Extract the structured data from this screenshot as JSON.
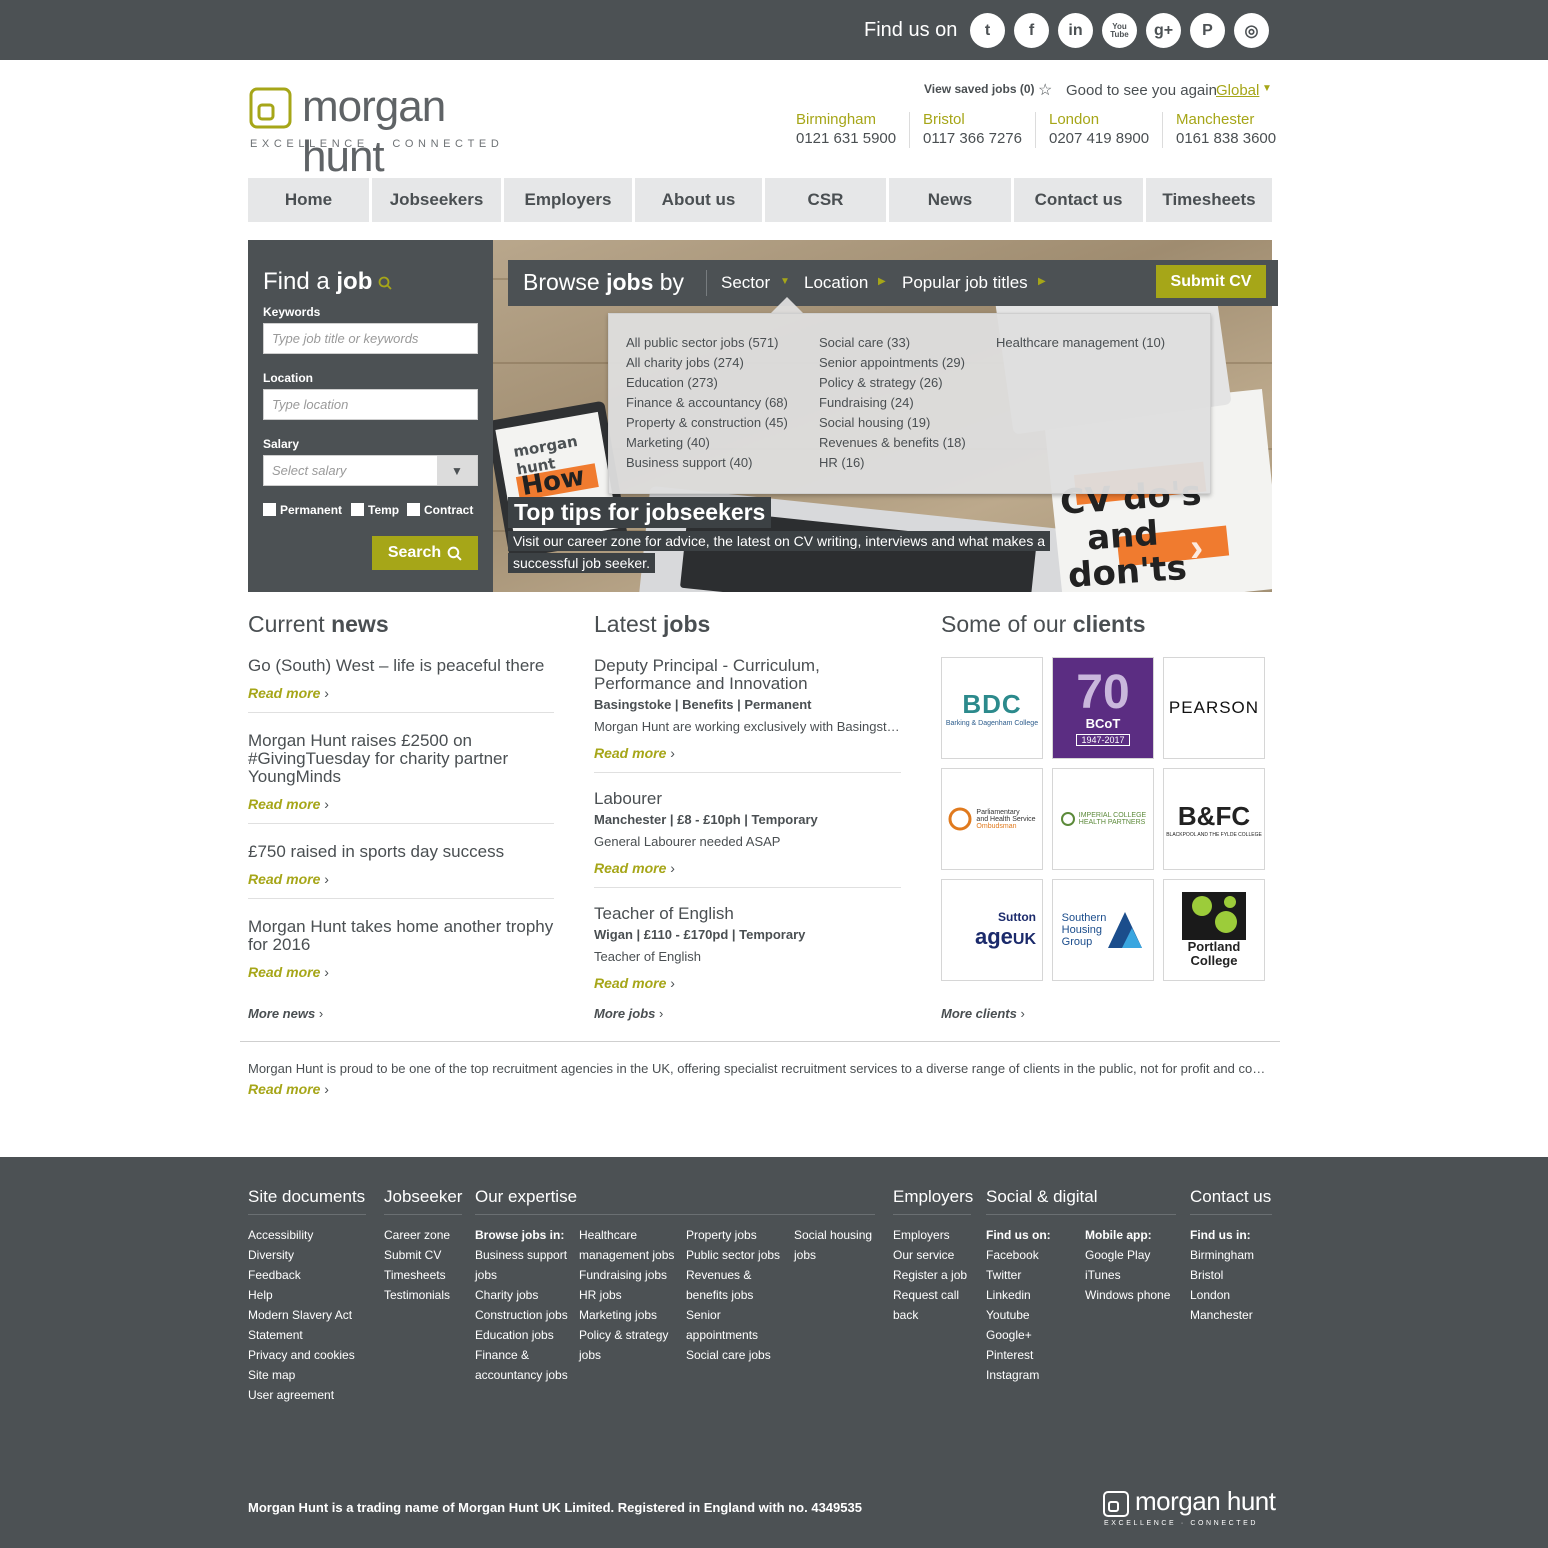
{
  "social": {
    "label": "Find us on",
    "icons": [
      {
        "name": "twitter-icon",
        "glyph": "t"
      },
      {
        "name": "facebook-icon",
        "glyph": "f"
      },
      {
        "name": "linkedin-icon",
        "glyph": "in"
      },
      {
        "name": "youtube-icon",
        "glyph": "You Tube"
      },
      {
        "name": "google-plus-icon",
        "glyph": "g+"
      },
      {
        "name": "pinterest-icon",
        "glyph": "P"
      },
      {
        "name": "instagram-icon",
        "glyph": "◎"
      }
    ]
  },
  "brand": {
    "name": "morgan hunt",
    "tagline": "EXCELLENCE · CONNECTED",
    "accent": "#a6a618",
    "dark": "#4c5154"
  },
  "header": {
    "saved_jobs": "View saved jobs (0)",
    "greeting": "Good to see you again",
    "user": "Global",
    "offices": [
      {
        "city": "Birmingham",
        "phone": "0121 631 5900"
      },
      {
        "city": "Bristol",
        "phone": "0117 366 7276"
      },
      {
        "city": "London",
        "phone": "0207 419 8900"
      },
      {
        "city": "Manchester",
        "phone": "0161 838 3600"
      }
    ]
  },
  "nav": [
    "Home",
    "Jobseekers",
    "Employers",
    "About us",
    "CSR",
    "News",
    "Contact us",
    "Timesheets"
  ],
  "find_job": {
    "title_light": "Find a",
    "title_bold": "job",
    "keywords_label": "Keywords",
    "keywords_placeholder": "Type job title or keywords",
    "location_label": "Location",
    "location_placeholder": "Type location",
    "salary_label": "Salary",
    "salary_placeholder": "Select salary",
    "checkboxes": [
      "Permanent",
      "Temp",
      "Contract"
    ],
    "search_label": "Search"
  },
  "browse": {
    "title_light": "Browse",
    "title_bold": "jobs",
    "title_end": "by",
    "sector": "Sector",
    "location": "Location",
    "popular": "Popular job titles",
    "submit_cv": "Submit CV",
    "sectors": [
      [
        "All public sector jobs (571)",
        "All charity jobs (274)",
        "Education (273)",
        "Finance & accountancy (68)",
        "Property & construction (45)",
        "Marketing (40)",
        "Business support (40)"
      ],
      [
        "Social care (33)",
        "Senior appointments (29)",
        "Policy & strategy (26)",
        "Fundraising (24)",
        "Social housing (19)",
        "Revenues & benefits (18)",
        "HR (16)"
      ],
      [
        "Healthcare management (10)"
      ]
    ]
  },
  "hero": {
    "title": "Top tips for jobseekers",
    "text": "Visit our career zone for advice, the latest on CV writing, interviews and what makes a successful job seeker.",
    "art_how": "How",
    "art_cv": "CV do's",
    "art_and": "and",
    "art_donts": "don'ts"
  },
  "news": {
    "title_light": "Current",
    "title_bold": "news",
    "items": [
      "Go (South) West – life is peaceful there",
      "Morgan Hunt raises £2500 on #GivingTuesday for charity partner YoungMinds",
      "£750 raised in sports day success",
      "Morgan Hunt takes home another trophy for 2016"
    ],
    "read_more": "Read more",
    "more": "More news"
  },
  "jobs": {
    "title_light": "Latest",
    "title_bold": "jobs",
    "items": [
      {
        "title": "Deputy Principal - Curriculum, Performance and Innovation",
        "meta": "Basingstoke | Benefits | Permanent",
        "desc": "Morgan Hunt are working exclusively with Basingstoke College of Technology to recruit a Deputy Principal"
      },
      {
        "title": "Labourer",
        "meta": "Manchester | £8 - £10ph | Temporary",
        "desc": "General Labourer needed ASAP"
      },
      {
        "title": "Teacher of English",
        "meta": "Wigan | £110 - £170pd | Temporary",
        "desc": "Teacher of English"
      }
    ],
    "read_more": "Read more",
    "more": "More jobs"
  },
  "clients": {
    "title_light": "Some of our",
    "title_bold": "clients",
    "logos": {
      "bdc": "BDC",
      "bdc_sub": "Barking & Dagenham College",
      "bcot_num": "70",
      "bcot_name": "BCoT",
      "bcot_years": "1947-2017",
      "pearson": "PEARSON",
      "phso1": "Parliamentary",
      "phso2": "and Health Service",
      "phso3": "Ombudsman",
      "imperial1": "IMPERIAL COLLEGE",
      "imperial2": "HEALTH PARTNERS",
      "bfc": "B&FC",
      "bfc_sub": "BLACKPOOL AND THE FYLDE COLLEGE",
      "age1": "Sutton",
      "age2": "age",
      "age3": "UK",
      "shg1": "Southern",
      "shg2": "Housing",
      "shg3": "Group",
      "portland1": "Portland",
      "portland2": "College"
    },
    "more": "More clients"
  },
  "about": {
    "text": "Morgan Hunt is proud to be one of the top recruitment agencies in the UK, offering specialist recruitment services to a diverse range of clients in the public, not for profit and commercial sectors.",
    "read_more": "Read more"
  },
  "footer": {
    "site_docs": {
      "title": "Site documents",
      "items": [
        "Accessibility",
        "Diversity",
        "Feedback",
        "Help",
        "Modern Slavery Act",
        "Statement",
        "Privacy and cookies",
        "Site map",
        "User agreement"
      ]
    },
    "jobseeker": {
      "title": "Jobseeker",
      "items": [
        "Career zone",
        "Submit CV",
        "Timesheets",
        "Testimonials"
      ]
    },
    "expertise": {
      "title": "Our expertise",
      "col1": [
        "Browse jobs in:",
        "Business support",
        "jobs",
        "Charity jobs",
        "Construction jobs",
        "Education jobs",
        "Finance &",
        "accountancy jobs"
      ],
      "col2": [
        "Healthcare",
        "management jobs",
        "Fundraising jobs",
        "HR jobs",
        "Marketing jobs",
        "Policy & strategy",
        "jobs"
      ],
      "col3": [
        "Property jobs",
        "Public sector jobs",
        "Revenues &",
        "benefits jobs",
        "Senior",
        "appointments",
        "Social care jobs"
      ],
      "col4": [
        "Social housing",
        "jobs"
      ]
    },
    "employers": {
      "title": "Employers",
      "items": [
        "Employers",
        "Our service",
        "Register a job",
        "Request call",
        "back"
      ]
    },
    "social": {
      "title": "Social & digital",
      "find": [
        "Find us on:",
        "Facebook",
        "Twitter",
        "Linkedin",
        "Youtube",
        "Google+",
        "Pinterest",
        "Instagram"
      ],
      "mobile": [
        "Mobile app:",
        "Google Play",
        "iTunes",
        "Windows phone"
      ]
    },
    "contact": {
      "title": "Contact us",
      "items": [
        "Find us in:",
        "Birmingham",
        "Bristol",
        "London",
        "Manchester"
      ]
    },
    "legal": "Morgan Hunt is a trading name of Morgan Hunt UK Limited. Registered in England with no. 4349535"
  }
}
